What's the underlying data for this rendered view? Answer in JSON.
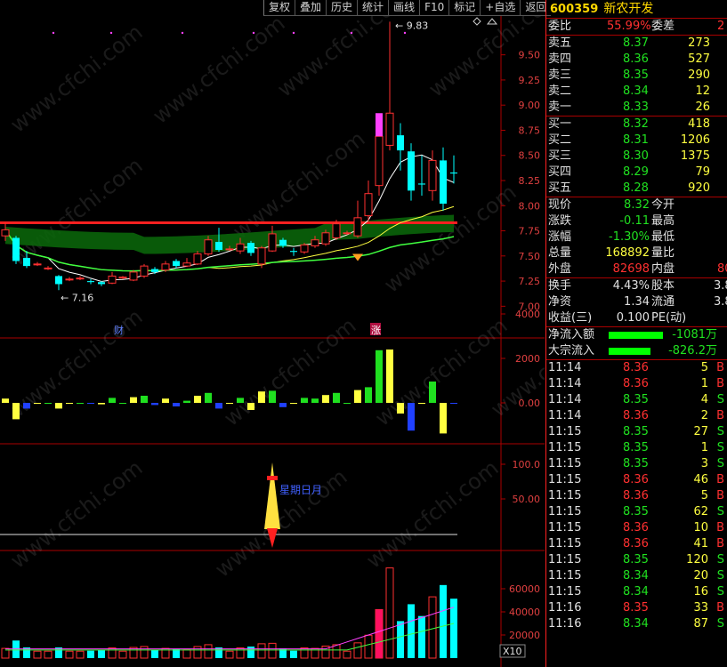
{
  "toolbar": {
    "buttons": [
      "复权",
      "叠加",
      "历史",
      "统计",
      "画线",
      "F10",
      "标记",
      "+自选",
      "返回"
    ]
  },
  "watermark": "www.cfchi.com",
  "colors": {
    "up": "#ff3030",
    "down": "#20e020",
    "accent": "#ffd800"
  },
  "chart_data": {
    "type": "candlestick",
    "price_panel": {
      "y_ticks": [
        "9.50",
        "9.25",
        "9.00",
        "8.75",
        "8.50",
        "8.25",
        "8.00",
        "7.75",
        "7.50",
        "7.25",
        "7.00"
      ],
      "ylim": [
        6.95,
        9.78
      ],
      "annotations": {
        "high_label": "9.83",
        "low_label": "7.16"
      },
      "event_marks": [
        "财",
        "涨"
      ],
      "resistance_level": 7.83,
      "candles": [
        {
          "o": 7.7,
          "c": 7.76,
          "h": 7.83,
          "l": 7.65
        },
        {
          "o": 7.68,
          "c": 7.45,
          "h": 7.7,
          "l": 7.42
        },
        {
          "o": 7.48,
          "c": 7.4,
          "h": 7.55,
          "l": 7.38
        },
        {
          "o": 7.42,
          "c": 7.42,
          "h": 7.44,
          "l": 7.4
        },
        {
          "o": 7.38,
          "c": 7.38,
          "h": 7.4,
          "l": 7.36
        },
        {
          "o": 7.3,
          "c": 7.22,
          "h": 7.31,
          "l": 7.16
        },
        {
          "o": 7.27,
          "c": 7.27,
          "h": 7.29,
          "l": 7.25
        },
        {
          "o": 7.28,
          "c": 7.28,
          "h": 7.3,
          "l": 7.26
        },
        {
          "o": 7.25,
          "c": 7.24,
          "h": 7.27,
          "l": 7.22
        },
        {
          "o": 7.24,
          "c": 7.22,
          "h": 7.25,
          "l": 7.2
        },
        {
          "o": 7.23,
          "c": 7.3,
          "h": 7.34,
          "l": 7.22
        },
        {
          "o": 7.29,
          "c": 7.29,
          "h": 7.3,
          "l": 7.27
        },
        {
          "o": 7.26,
          "c": 7.34,
          "h": 7.36,
          "l": 7.25
        },
        {
          "o": 7.3,
          "c": 7.4,
          "h": 7.42,
          "l": 7.28
        },
        {
          "o": 7.37,
          "c": 7.34,
          "h": 7.39,
          "l": 7.32
        },
        {
          "o": 7.36,
          "c": 7.42,
          "h": 7.45,
          "l": 7.34
        },
        {
          "o": 7.45,
          "c": 7.4,
          "h": 7.47,
          "l": 7.38
        },
        {
          "o": 7.4,
          "c": 7.43,
          "h": 7.48,
          "l": 7.39
        },
        {
          "o": 7.42,
          "c": 7.52,
          "h": 7.55,
          "l": 7.41
        },
        {
          "o": 7.52,
          "c": 7.66,
          "h": 7.7,
          "l": 7.5
        },
        {
          "o": 7.64,
          "c": 7.56,
          "h": 7.78,
          "l": 7.54
        },
        {
          "o": 7.57,
          "c": 7.57,
          "h": 7.6,
          "l": 7.55
        },
        {
          "o": 7.55,
          "c": 7.62,
          "h": 7.68,
          "l": 7.52
        },
        {
          "o": 7.63,
          "c": 7.53,
          "h": 7.65,
          "l": 7.5
        },
        {
          "o": 7.42,
          "c": 7.58,
          "h": 7.6,
          "l": 7.38
        },
        {
          "o": 7.55,
          "c": 7.72,
          "h": 7.8,
          "l": 7.54
        },
        {
          "o": 7.66,
          "c": 7.6,
          "h": 7.68,
          "l": 7.58
        },
        {
          "o": 7.55,
          "c": 7.54,
          "h": 7.58,
          "l": 7.5
        },
        {
          "o": 7.54,
          "c": 7.61,
          "h": 7.63,
          "l": 7.52
        },
        {
          "o": 7.6,
          "c": 7.66,
          "h": 7.7,
          "l": 7.58
        },
        {
          "o": 7.62,
          "c": 7.73,
          "h": 7.76,
          "l": 7.6
        },
        {
          "o": 7.68,
          "c": 7.82,
          "h": 7.86,
          "l": 7.66
        },
        {
          "o": 7.73,
          "c": 7.73,
          "h": 7.75,
          "l": 7.71
        },
        {
          "o": 7.7,
          "c": 7.88,
          "h": 8.05,
          "l": 7.68
        },
        {
          "o": 7.9,
          "c": 8.12,
          "h": 8.25,
          "l": 7.85
        },
        {
          "o": 8.2,
          "c": 8.69,
          "h": 8.8,
          "l": 8.1
        },
        {
          "o": 8.6,
          "c": 8.92,
          "h": 9.83,
          "l": 8.55
        },
        {
          "o": 8.7,
          "c": 8.55,
          "h": 8.82,
          "l": 8.35
        },
        {
          "o": 8.54,
          "c": 8.15,
          "h": 8.62,
          "l": 8.05
        },
        {
          "o": 8.22,
          "c": 8.21,
          "h": 8.5,
          "l": 8.1
        },
        {
          "o": 8.15,
          "c": 8.45,
          "h": 8.55,
          "l": 8.05
        },
        {
          "o": 8.45,
          "c": 8.02,
          "h": 8.58,
          "l": 7.95
        },
        {
          "o": 8.33,
          "c": 8.32,
          "h": 8.5,
          "l": 8.22
        }
      ]
    },
    "flow_panel": {
      "y_ticks": [
        "4000",
        "2000",
        "0.00"
      ]
    },
    "signal_panel": {
      "y_ticks": [
        "100.0",
        "50.00"
      ],
      "label": "星期日月"
    },
    "volume_panel": {
      "y_ticks": [
        "60000",
        "40000",
        "20000"
      ],
      "unit_label": "X10"
    }
  },
  "quote": {
    "code": "600359",
    "name": "新农开发",
    "webi_label": "委比",
    "webi": "55.99%",
    "weicha_label": "委差",
    "weicha": "2",
    "asks": [
      {
        "label": "卖五",
        "price": "8.37",
        "vol": "273"
      },
      {
        "label": "卖四",
        "price": "8.36",
        "vol": "527"
      },
      {
        "label": "卖三",
        "price": "8.35",
        "vol": "290"
      },
      {
        "label": "卖二",
        "price": "8.34",
        "vol": "12"
      },
      {
        "label": "卖一",
        "price": "8.33",
        "vol": "26"
      }
    ],
    "bids": [
      {
        "label": "买一",
        "price": "8.32",
        "vol": "418"
      },
      {
        "label": "买二",
        "price": "8.31",
        "vol": "1206"
      },
      {
        "label": "买三",
        "price": "8.30",
        "vol": "1375"
      },
      {
        "label": "买四",
        "price": "8.29",
        "vol": "79"
      },
      {
        "label": "买五",
        "price": "8.28",
        "vol": "920"
      }
    ],
    "stats": [
      {
        "l1": "现价",
        "v1": "8.32",
        "l2": "今开",
        "v2": "",
        "c": "green"
      },
      {
        "l1": "涨跌",
        "v1": "-0.11",
        "l2": "最高",
        "v2": "",
        "c": "green"
      },
      {
        "l1": "涨幅",
        "v1": "-1.30%",
        "l2": "最低",
        "v2": "",
        "c": "green"
      },
      {
        "l1": "总量",
        "v1": "168892",
        "l2": "量比",
        "v2": "",
        "c": "yellow"
      },
      {
        "l1": "外盘",
        "v1": "82698",
        "l2": "内盘",
        "v2": "80",
        "c": "red"
      }
    ],
    "stats2": [
      {
        "l1": "换手",
        "v1": "4.43%",
        "l2": "股本",
        "v2": "3.8"
      },
      {
        "l1": "净资",
        "v1": "1.34",
        "l2": "流通",
        "v2": "3.8"
      },
      {
        "l1": "收益(三)",
        "v1": "0.100",
        "l2": "PE(动)",
        "v2": ""
      }
    ],
    "flows": [
      {
        "label": "净流入额",
        "value": "-1081万",
        "bar": 0.72
      },
      {
        "label": "大宗流入",
        "value": "-826.2万",
        "bar": 0.55
      }
    ],
    "ticks": [
      {
        "t": "11:14",
        "p": "8.36",
        "v": "5",
        "s": "B"
      },
      {
        "t": "11:14",
        "p": "8.36",
        "v": "1",
        "s": "B"
      },
      {
        "t": "11:14",
        "p": "8.35",
        "v": "4",
        "s": "S"
      },
      {
        "t": "11:14",
        "p": "8.36",
        "v": "2",
        "s": "B"
      },
      {
        "t": "11:15",
        "p": "8.35",
        "v": "27",
        "s": "S"
      },
      {
        "t": "11:15",
        "p": "8.35",
        "v": "1",
        "s": "S"
      },
      {
        "t": "11:15",
        "p": "8.35",
        "v": "3",
        "s": "S"
      },
      {
        "t": "11:15",
        "p": "8.36",
        "v": "46",
        "s": "B"
      },
      {
        "t": "11:15",
        "p": "8.36",
        "v": "5",
        "s": "B"
      },
      {
        "t": "11:15",
        "p": "8.35",
        "v": "62",
        "s": "S"
      },
      {
        "t": "11:15",
        "p": "8.36",
        "v": "10",
        "s": "B"
      },
      {
        "t": "11:15",
        "p": "8.36",
        "v": "41",
        "s": "B"
      },
      {
        "t": "11:15",
        "p": "8.35",
        "v": "120",
        "s": "S"
      },
      {
        "t": "11:15",
        "p": "8.34",
        "v": "20",
        "s": "S"
      },
      {
        "t": "11:15",
        "p": "8.34",
        "v": "16",
        "s": "S"
      },
      {
        "t": "11:16",
        "p": "8.35",
        "v": "33",
        "s": "B"
      },
      {
        "t": "11:16",
        "p": "8.34",
        "v": "87",
        "s": "S"
      }
    ]
  }
}
